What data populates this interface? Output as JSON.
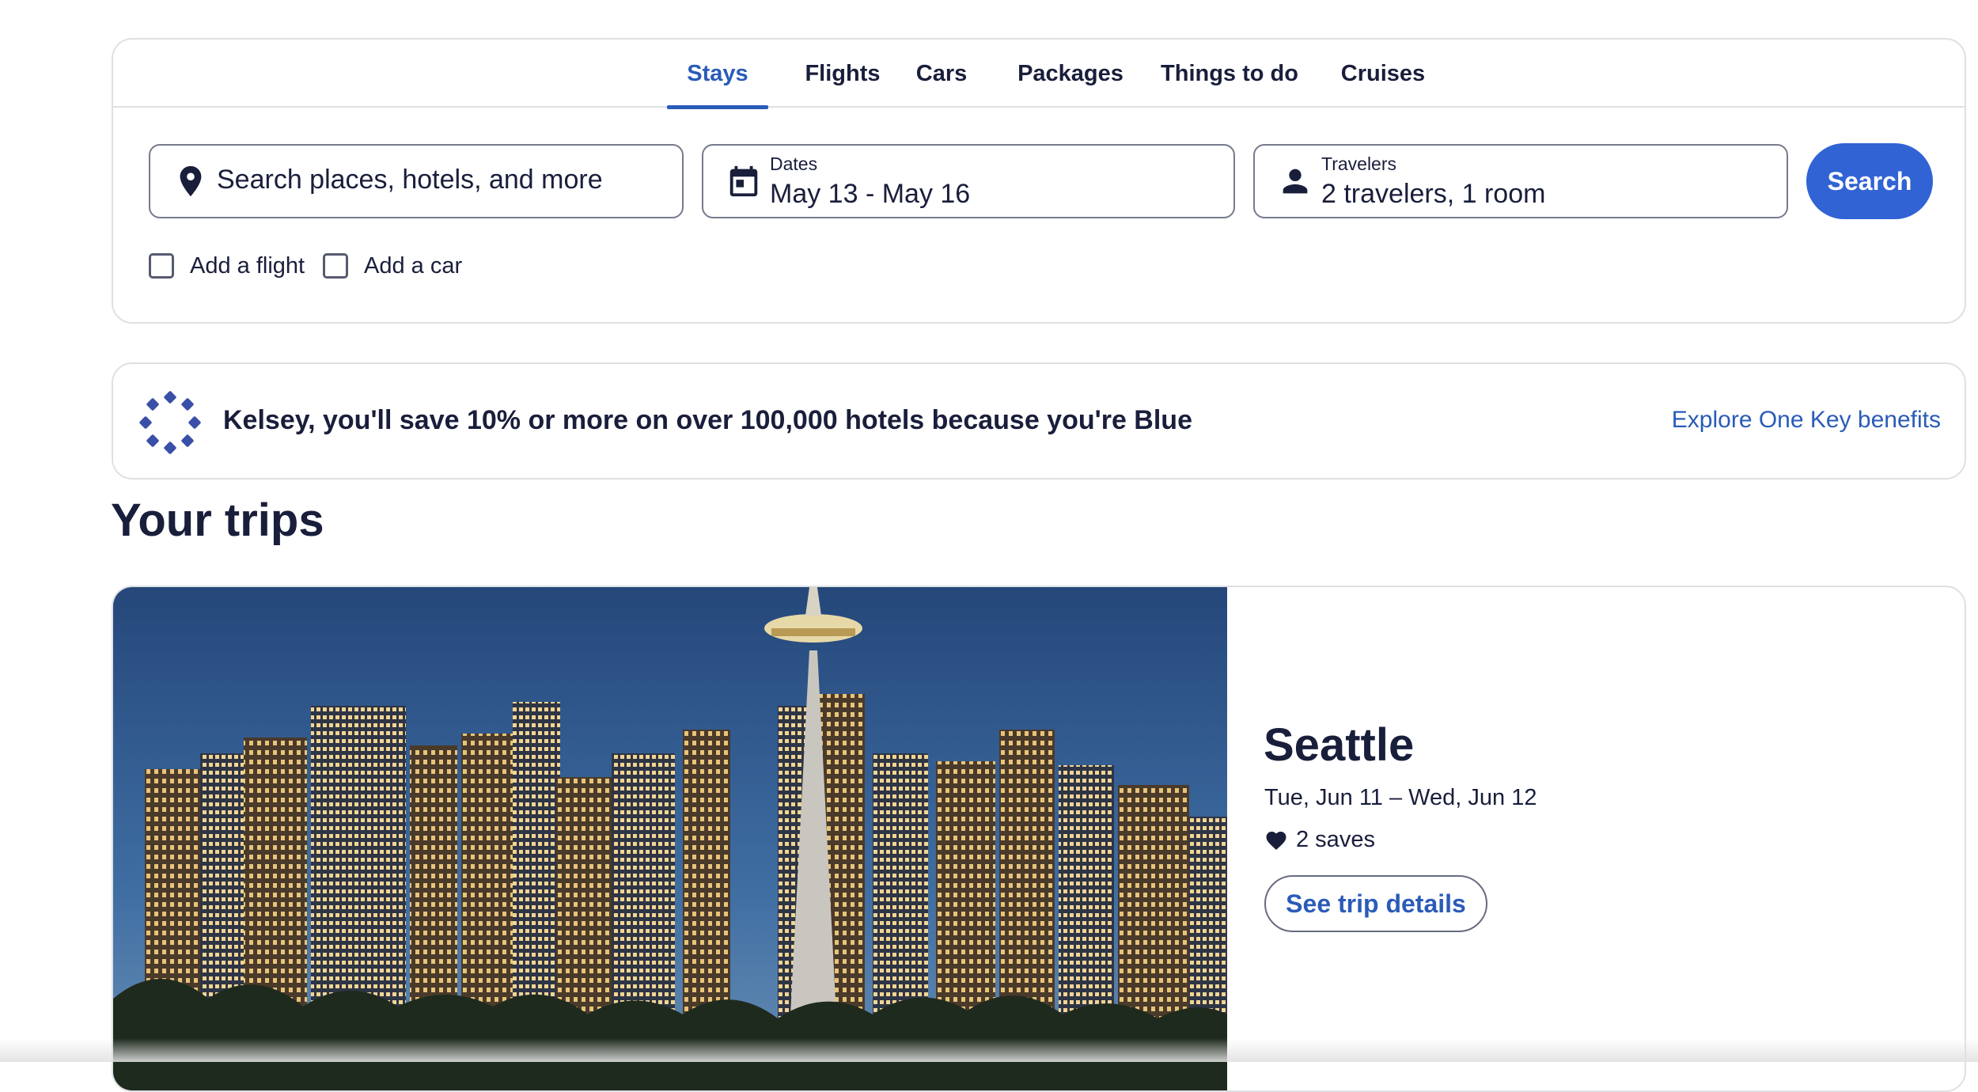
{
  "tabs": [
    {
      "label": "Stays",
      "active": true
    },
    {
      "label": "Flights",
      "active": false
    },
    {
      "label": "Cars",
      "active": false
    },
    {
      "label": "Packages",
      "active": false
    },
    {
      "label": "Things to do",
      "active": false
    },
    {
      "label": "Cruises",
      "active": false
    }
  ],
  "search": {
    "destination_placeholder": "Search places, hotels, and more",
    "dates_label": "Dates",
    "dates_value": "May 13 - May 16",
    "travelers_label": "Travelers",
    "travelers_value": "2 travelers, 1 room",
    "search_button": "Search",
    "add_flight": "Add a flight",
    "add_car": "Add a car"
  },
  "banner": {
    "message": "Kelsey, you'll save 10% or more on over 100,000 hotels because you're Blue",
    "link": "Explore One Key benefits",
    "logo_icon": "one-key-logo-icon",
    "logo_color": "#3a4fa8"
  },
  "trips": {
    "heading": "Your trips",
    "card": {
      "image_icon": "seattle-skyline-photo",
      "city": "Seattle",
      "dates": "Tue, Jun 11 – Wed, Jun 12",
      "saves": "2 saves",
      "button": "See trip details"
    }
  },
  "colors": {
    "accent": "#2a5bb8",
    "primary_button": "#3163d5",
    "text": "#191e3b",
    "border": "#dfe0e4"
  }
}
